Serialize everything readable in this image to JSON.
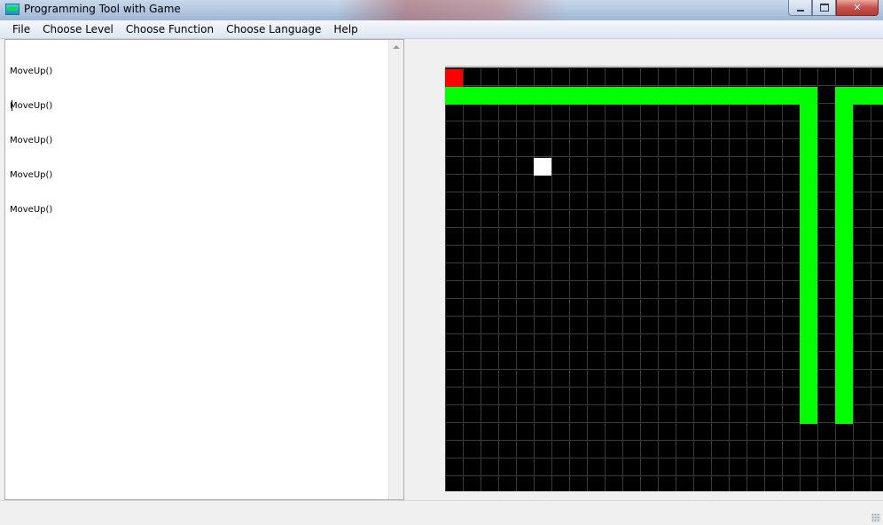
{
  "window": {
    "title": "Programming Tool with Game",
    "minimize_glyph": "minimize-icon",
    "maximize_glyph": "maximize-icon",
    "close_label": "✕"
  },
  "menu": [
    {
      "label": "File"
    },
    {
      "label": "Choose Level"
    },
    {
      "label": "Choose Function"
    },
    {
      "label": "Choose Language"
    },
    {
      "label": "Help"
    }
  ],
  "editor": {
    "lines": [
      "MoveUp()",
      "MoveUp()",
      "MoveUp()",
      "MoveUp()",
      "MoveUp()"
    ]
  },
  "game": {
    "colors": {
      "background": "#000000",
      "grid_line": "#3a3a3a",
      "wall": "#00ff00",
      "player": "#ff0000",
      "target": "#ffffff"
    },
    "player_cell": {
      "col": 0,
      "row": 0
    },
    "target_cell": {
      "col": 5,
      "row": 5
    },
    "walls": [
      {
        "col": 0,
        "row": 1,
        "cols": 21,
        "rows": 1
      },
      {
        "col": 20,
        "row": 1,
        "cols": 1,
        "rows": 19
      },
      {
        "col": 22,
        "row": 1,
        "cols": 3,
        "rows": 1
      },
      {
        "col": 22,
        "row": 1,
        "cols": 1,
        "rows": 19
      }
    ]
  }
}
